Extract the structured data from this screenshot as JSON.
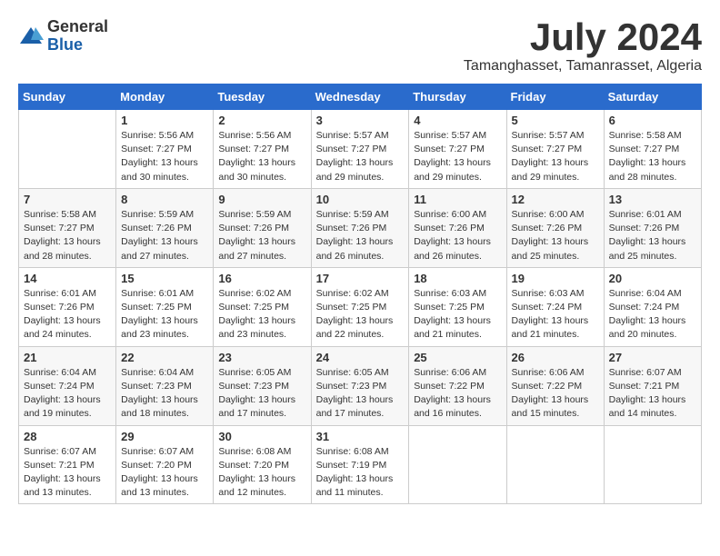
{
  "logo": {
    "general": "General",
    "blue": "Blue"
  },
  "title": {
    "month_year": "July 2024",
    "location": "Tamanghasset, Tamanrasset, Algeria"
  },
  "headers": [
    "Sunday",
    "Monday",
    "Tuesday",
    "Wednesday",
    "Thursday",
    "Friday",
    "Saturday"
  ],
  "weeks": [
    [
      {
        "day": "",
        "info": ""
      },
      {
        "day": "1",
        "info": "Sunrise: 5:56 AM\nSunset: 7:27 PM\nDaylight: 13 hours\nand 30 minutes."
      },
      {
        "day": "2",
        "info": "Sunrise: 5:56 AM\nSunset: 7:27 PM\nDaylight: 13 hours\nand 30 minutes."
      },
      {
        "day": "3",
        "info": "Sunrise: 5:57 AM\nSunset: 7:27 PM\nDaylight: 13 hours\nand 29 minutes."
      },
      {
        "day": "4",
        "info": "Sunrise: 5:57 AM\nSunset: 7:27 PM\nDaylight: 13 hours\nand 29 minutes."
      },
      {
        "day": "5",
        "info": "Sunrise: 5:57 AM\nSunset: 7:27 PM\nDaylight: 13 hours\nand 29 minutes."
      },
      {
        "day": "6",
        "info": "Sunrise: 5:58 AM\nSunset: 7:27 PM\nDaylight: 13 hours\nand 28 minutes."
      }
    ],
    [
      {
        "day": "7",
        "info": "Sunrise: 5:58 AM\nSunset: 7:27 PM\nDaylight: 13 hours\nand 28 minutes."
      },
      {
        "day": "8",
        "info": "Sunrise: 5:59 AM\nSunset: 7:26 PM\nDaylight: 13 hours\nand 27 minutes."
      },
      {
        "day": "9",
        "info": "Sunrise: 5:59 AM\nSunset: 7:26 PM\nDaylight: 13 hours\nand 27 minutes."
      },
      {
        "day": "10",
        "info": "Sunrise: 5:59 AM\nSunset: 7:26 PM\nDaylight: 13 hours\nand 26 minutes."
      },
      {
        "day": "11",
        "info": "Sunrise: 6:00 AM\nSunset: 7:26 PM\nDaylight: 13 hours\nand 26 minutes."
      },
      {
        "day": "12",
        "info": "Sunrise: 6:00 AM\nSunset: 7:26 PM\nDaylight: 13 hours\nand 25 minutes."
      },
      {
        "day": "13",
        "info": "Sunrise: 6:01 AM\nSunset: 7:26 PM\nDaylight: 13 hours\nand 25 minutes."
      }
    ],
    [
      {
        "day": "14",
        "info": "Sunrise: 6:01 AM\nSunset: 7:26 PM\nDaylight: 13 hours\nand 24 minutes."
      },
      {
        "day": "15",
        "info": "Sunrise: 6:01 AM\nSunset: 7:25 PM\nDaylight: 13 hours\nand 23 minutes."
      },
      {
        "day": "16",
        "info": "Sunrise: 6:02 AM\nSunset: 7:25 PM\nDaylight: 13 hours\nand 23 minutes."
      },
      {
        "day": "17",
        "info": "Sunrise: 6:02 AM\nSunset: 7:25 PM\nDaylight: 13 hours\nand 22 minutes."
      },
      {
        "day": "18",
        "info": "Sunrise: 6:03 AM\nSunset: 7:25 PM\nDaylight: 13 hours\nand 21 minutes."
      },
      {
        "day": "19",
        "info": "Sunrise: 6:03 AM\nSunset: 7:24 PM\nDaylight: 13 hours\nand 21 minutes."
      },
      {
        "day": "20",
        "info": "Sunrise: 6:04 AM\nSunset: 7:24 PM\nDaylight: 13 hours\nand 20 minutes."
      }
    ],
    [
      {
        "day": "21",
        "info": "Sunrise: 6:04 AM\nSunset: 7:24 PM\nDaylight: 13 hours\nand 19 minutes."
      },
      {
        "day": "22",
        "info": "Sunrise: 6:04 AM\nSunset: 7:23 PM\nDaylight: 13 hours\nand 18 minutes."
      },
      {
        "day": "23",
        "info": "Sunrise: 6:05 AM\nSunset: 7:23 PM\nDaylight: 13 hours\nand 17 minutes."
      },
      {
        "day": "24",
        "info": "Sunrise: 6:05 AM\nSunset: 7:23 PM\nDaylight: 13 hours\nand 17 minutes."
      },
      {
        "day": "25",
        "info": "Sunrise: 6:06 AM\nSunset: 7:22 PM\nDaylight: 13 hours\nand 16 minutes."
      },
      {
        "day": "26",
        "info": "Sunrise: 6:06 AM\nSunset: 7:22 PM\nDaylight: 13 hours\nand 15 minutes."
      },
      {
        "day": "27",
        "info": "Sunrise: 6:07 AM\nSunset: 7:21 PM\nDaylight: 13 hours\nand 14 minutes."
      }
    ],
    [
      {
        "day": "28",
        "info": "Sunrise: 6:07 AM\nSunset: 7:21 PM\nDaylight: 13 hours\nand 13 minutes."
      },
      {
        "day": "29",
        "info": "Sunrise: 6:07 AM\nSunset: 7:20 PM\nDaylight: 13 hours\nand 13 minutes."
      },
      {
        "day": "30",
        "info": "Sunrise: 6:08 AM\nSunset: 7:20 PM\nDaylight: 13 hours\nand 12 minutes."
      },
      {
        "day": "31",
        "info": "Sunrise: 6:08 AM\nSunset: 7:19 PM\nDaylight: 13 hours\nand 11 minutes."
      },
      {
        "day": "",
        "info": ""
      },
      {
        "day": "",
        "info": ""
      },
      {
        "day": "",
        "info": ""
      }
    ]
  ]
}
